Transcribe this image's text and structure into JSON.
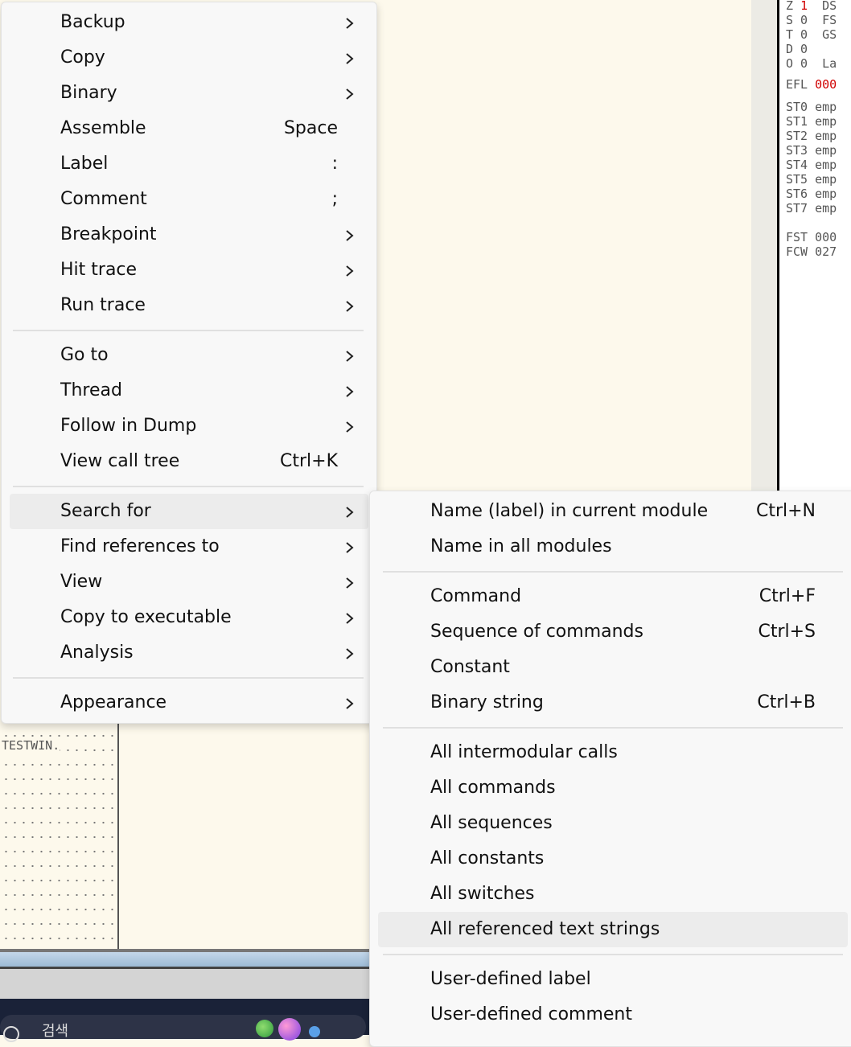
{
  "registers": {
    "lines": [
      "Z 1  DS",
      "S 0  FS",
      "T 0  GS",
      "D 0",
      "O 0  La"
    ],
    "efl_label": "EFL",
    "efl_value": "000",
    "st": [
      "ST0 emp",
      "ST1 emp",
      "ST2 emp",
      "ST3 emp",
      "ST4 emp",
      "ST5 emp",
      "ST6 emp",
      "ST7 emp"
    ],
    "fst": "FST 000",
    "fcw": "FCW 027"
  },
  "dump": {
    "text": "TESTWIN."
  },
  "taskbar": {
    "search_text": "검색"
  },
  "context_menu": {
    "items": [
      {
        "label": "Backup",
        "shortcut": "",
        "submenu": true
      },
      {
        "label": "Copy",
        "shortcut": "",
        "submenu": true
      },
      {
        "label": "Binary",
        "shortcut": "",
        "submenu": true
      },
      {
        "label": "Assemble",
        "shortcut": "Space",
        "submenu": false
      },
      {
        "label": "Label",
        "shortcut": ":",
        "submenu": false
      },
      {
        "label": "Comment",
        "shortcut": ";",
        "submenu": false
      },
      {
        "label": "Breakpoint",
        "shortcut": "",
        "submenu": true
      },
      {
        "label": "Hit trace",
        "shortcut": "",
        "submenu": true
      },
      {
        "label": "Run trace",
        "shortcut": "",
        "submenu": true
      },
      {
        "label": "Go to",
        "shortcut": "",
        "submenu": true
      },
      {
        "label": "Thread",
        "shortcut": "",
        "submenu": true
      },
      {
        "label": "Follow in Dump",
        "shortcut": "",
        "submenu": true
      },
      {
        "label": "View call tree",
        "shortcut": "Ctrl+K",
        "submenu": false
      },
      {
        "label": "Search for",
        "shortcut": "",
        "submenu": true
      },
      {
        "label": "Find references to",
        "shortcut": "",
        "submenu": true
      },
      {
        "label": "View",
        "shortcut": "",
        "submenu": true
      },
      {
        "label": "Copy to executable",
        "shortcut": "",
        "submenu": true
      },
      {
        "label": "Analysis",
        "shortcut": "",
        "submenu": true
      },
      {
        "label": "Appearance",
        "shortcut": "",
        "submenu": true
      }
    ]
  },
  "search_submenu": {
    "items": [
      {
        "label": "Name (label) in current module",
        "shortcut": "Ctrl+N"
      },
      {
        "label": "Name in all modules",
        "shortcut": ""
      },
      {
        "label": "Command",
        "shortcut": "Ctrl+F"
      },
      {
        "label": "Sequence of commands",
        "shortcut": "Ctrl+S"
      },
      {
        "label": "Constant",
        "shortcut": ""
      },
      {
        "label": "Binary string",
        "shortcut": "Ctrl+B"
      },
      {
        "label": "All intermodular calls",
        "shortcut": ""
      },
      {
        "label": "All commands",
        "shortcut": ""
      },
      {
        "label": "All sequences",
        "shortcut": ""
      },
      {
        "label": "All constants",
        "shortcut": ""
      },
      {
        "label": "All switches",
        "shortcut": ""
      },
      {
        "label": "All referenced text strings",
        "shortcut": ""
      },
      {
        "label": "User-defined label",
        "shortcut": ""
      },
      {
        "label": "User-defined comment",
        "shortcut": ""
      }
    ]
  }
}
